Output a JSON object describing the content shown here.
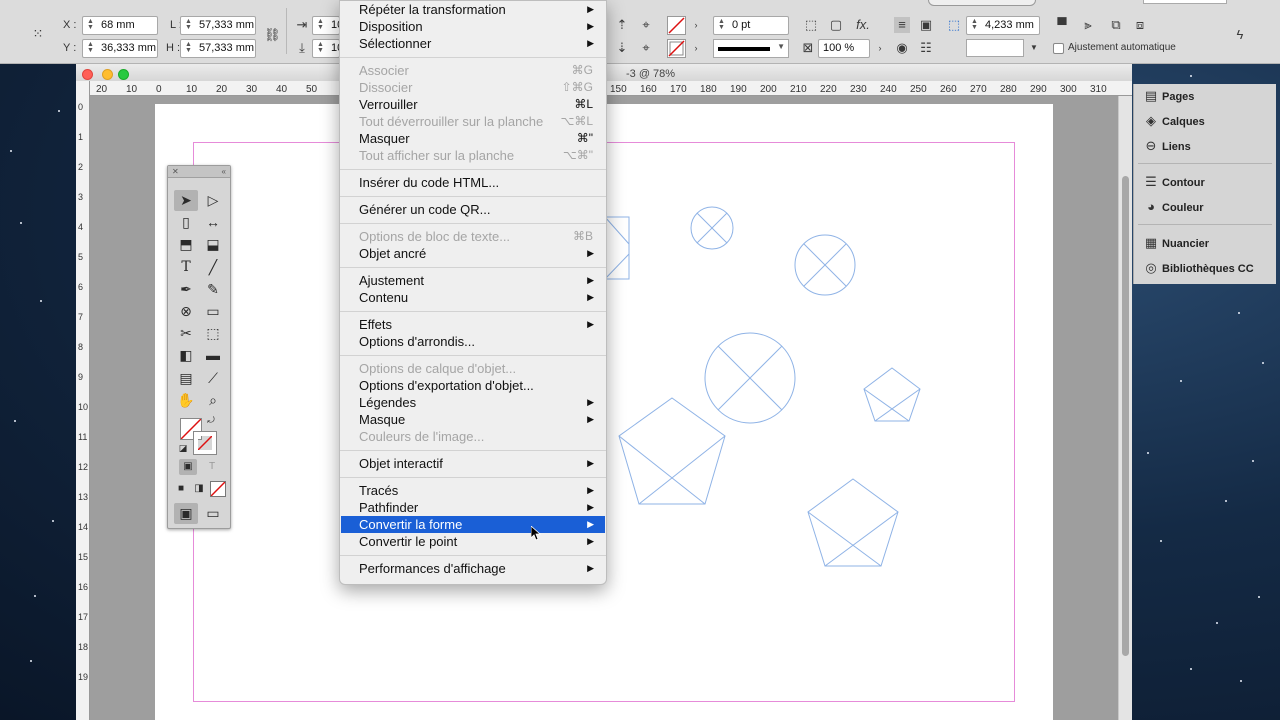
{
  "control_bar": {
    "x_label": "X :",
    "y_label": "Y :",
    "x_value": "68 mm",
    "y_value": "36,333 mm",
    "l_label": "L :",
    "h_label": "H :",
    "w_value": "57,333 mm",
    "h_value": "57,333 mm",
    "stroke_weight": "0 pt",
    "opacity": "100 %",
    "offset_value": "4,233 mm",
    "autofit_label": "Ajustement automatique",
    "fx_label": "fx.",
    "field_fragment_1": "10",
    "field_fragment_2": "10"
  },
  "document": {
    "title_fragment": "-3 @ 78%",
    "ruler_h": [
      "20",
      "10",
      "0",
      "10",
      "20",
      "30",
      "40",
      "50",
      "150",
      "160",
      "170",
      "180",
      "190",
      "200",
      "210",
      "220",
      "230",
      "240",
      "250",
      "260",
      "270",
      "280",
      "290",
      "300",
      "310"
    ],
    "ruler_v": [
      "0",
      "1",
      "2",
      "3",
      "4",
      "5",
      "6",
      "7",
      "8",
      "9",
      "10",
      "11",
      "12",
      "13",
      "14",
      "15",
      "16",
      "17",
      "18",
      "19"
    ]
  },
  "context_menu": {
    "groups": [
      [
        {
          "label": "Répéter la transformation",
          "submenu": true,
          "disabled": false
        },
        {
          "label": "Disposition",
          "submenu": true,
          "disabled": false
        },
        {
          "label": "Sélectionner",
          "submenu": true,
          "disabled": false
        }
      ],
      [
        {
          "label": "Associer",
          "shortcut": "⌘G",
          "disabled": true
        },
        {
          "label": "Dissocier",
          "shortcut": "⇧⌘G",
          "disabled": true
        },
        {
          "label": "Verrouiller",
          "shortcut": "⌘L",
          "disabled": false
        },
        {
          "label": "Tout déverrouiller sur la planche",
          "shortcut": "⌥⌘L",
          "disabled": true
        },
        {
          "label": "Masquer",
          "shortcut": "⌘\"",
          "disabled": false
        },
        {
          "label": "Tout afficher sur la planche",
          "shortcut": "⌥⌘\"",
          "disabled": true
        }
      ],
      [
        {
          "label": "Insérer du code HTML...",
          "disabled": false
        }
      ],
      [
        {
          "label": "Générer un code QR...",
          "disabled": false
        }
      ],
      [
        {
          "label": "Options de bloc de texte...",
          "shortcut": "⌘B",
          "disabled": true
        },
        {
          "label": "Objet ancré",
          "submenu": true,
          "disabled": false
        }
      ],
      [
        {
          "label": "Ajustement",
          "submenu": true,
          "disabled": false
        },
        {
          "label": "Contenu",
          "submenu": true,
          "disabled": false
        }
      ],
      [
        {
          "label": "Effets",
          "submenu": true,
          "disabled": false
        },
        {
          "label": "Options d'arrondis...",
          "disabled": false
        }
      ],
      [
        {
          "label": "Options de calque d'objet...",
          "disabled": true
        },
        {
          "label": "Options d'exportation d'objet...",
          "disabled": false
        },
        {
          "label": "Légendes",
          "submenu": true,
          "disabled": false
        },
        {
          "label": "Masque",
          "submenu": true,
          "disabled": false
        },
        {
          "label": "Couleurs de l'image...",
          "disabled": true
        }
      ],
      [
        {
          "label": "Objet interactif",
          "submenu": true,
          "disabled": false
        }
      ],
      [
        {
          "label": "Tracés",
          "submenu": true,
          "disabled": false
        },
        {
          "label": "Pathfinder",
          "submenu": true,
          "disabled": false
        },
        {
          "label": "Convertir la forme",
          "submenu": true,
          "disabled": false,
          "highlighted": true
        },
        {
          "label": "Convertir le point",
          "submenu": true,
          "disabled": false
        }
      ],
      [
        {
          "label": "Performances d'affichage",
          "submenu": true,
          "disabled": false
        }
      ]
    ]
  },
  "right_panel": {
    "items": [
      {
        "label": "Pages",
        "icon": "pages-icon",
        "glyph": "▤"
      },
      {
        "label": "Calques",
        "icon": "layers-icon",
        "glyph": "◈"
      },
      {
        "label": "Liens",
        "icon": "links-icon",
        "glyph": "⊖"
      },
      {
        "label": "Contour",
        "icon": "stroke-icon",
        "glyph": "☰"
      },
      {
        "label": "Couleur",
        "icon": "color-icon",
        "glyph": "◕"
      },
      {
        "label": "Nuancier",
        "icon": "swatches-icon",
        "glyph": "▦"
      },
      {
        "label": "Bibliothèques CC",
        "icon": "cc-libraries-icon",
        "glyph": "◎"
      }
    ]
  },
  "colors": {
    "highlight": "#1a5fd6",
    "frame": "#8fb3e6",
    "margin_guide": "#e68bd9"
  }
}
